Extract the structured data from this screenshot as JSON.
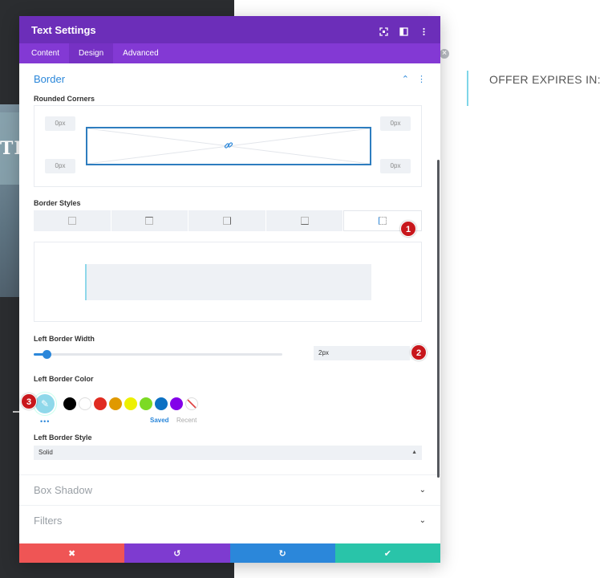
{
  "background": {
    "photo_text": "THE",
    "right_heading": "OFFER EXPIRES IN:"
  },
  "modal": {
    "title": "Text Settings",
    "header_icons": [
      "fullscreen-icon",
      "sidebar-icon",
      "more-vertical-icon"
    ],
    "tabs": [
      {
        "label": "Content",
        "active": false
      },
      {
        "label": "Design",
        "active": true
      },
      {
        "label": "Advanced",
        "active": false
      }
    ]
  },
  "border": {
    "title": "Border",
    "rounded_corners_label": "Rounded Corners",
    "corners": {
      "top_left": "0px",
      "top_right": "0px",
      "bottom_left": "0px",
      "bottom_right": "0px"
    },
    "border_styles_label": "Border Styles",
    "border_style_tabs": [
      "all",
      "top",
      "right",
      "bottom",
      "left"
    ],
    "active_border_style": "left",
    "left_border_width_label": "Left Border Width",
    "left_border_width_value": "2px",
    "left_border_width_fraction": 0.05,
    "left_border_color_label": "Left Border Color",
    "selected_color": "#8fd8ea",
    "swatches": [
      "#000000",
      "#ffffff",
      "#e02b20",
      "#e09900",
      "#edf000",
      "#7cda24",
      "#0c71c3",
      "#8300e9"
    ],
    "saved_label": "Saved",
    "recent_label": "Recent",
    "left_border_style_label": "Left Border Style",
    "left_border_style_value": "Solid"
  },
  "sections": [
    {
      "title": "Box Shadow"
    },
    {
      "title": "Filters"
    }
  ],
  "footer": {
    "buttons": [
      {
        "name": "cancel",
        "symbol": "✖",
        "color": "#ef5555"
      },
      {
        "name": "undo",
        "symbol": "↺",
        "color": "#7e3bd0"
      },
      {
        "name": "redo",
        "symbol": "↻",
        "color": "#2b87da"
      },
      {
        "name": "save",
        "symbol": "✔",
        "color": "#29c4a9"
      }
    ]
  },
  "callouts": [
    "1",
    "2",
    "3"
  ],
  "colors": {
    "header": "#6c2eb9",
    "tabs": "#8339d4",
    "accent": "#2b87da"
  }
}
